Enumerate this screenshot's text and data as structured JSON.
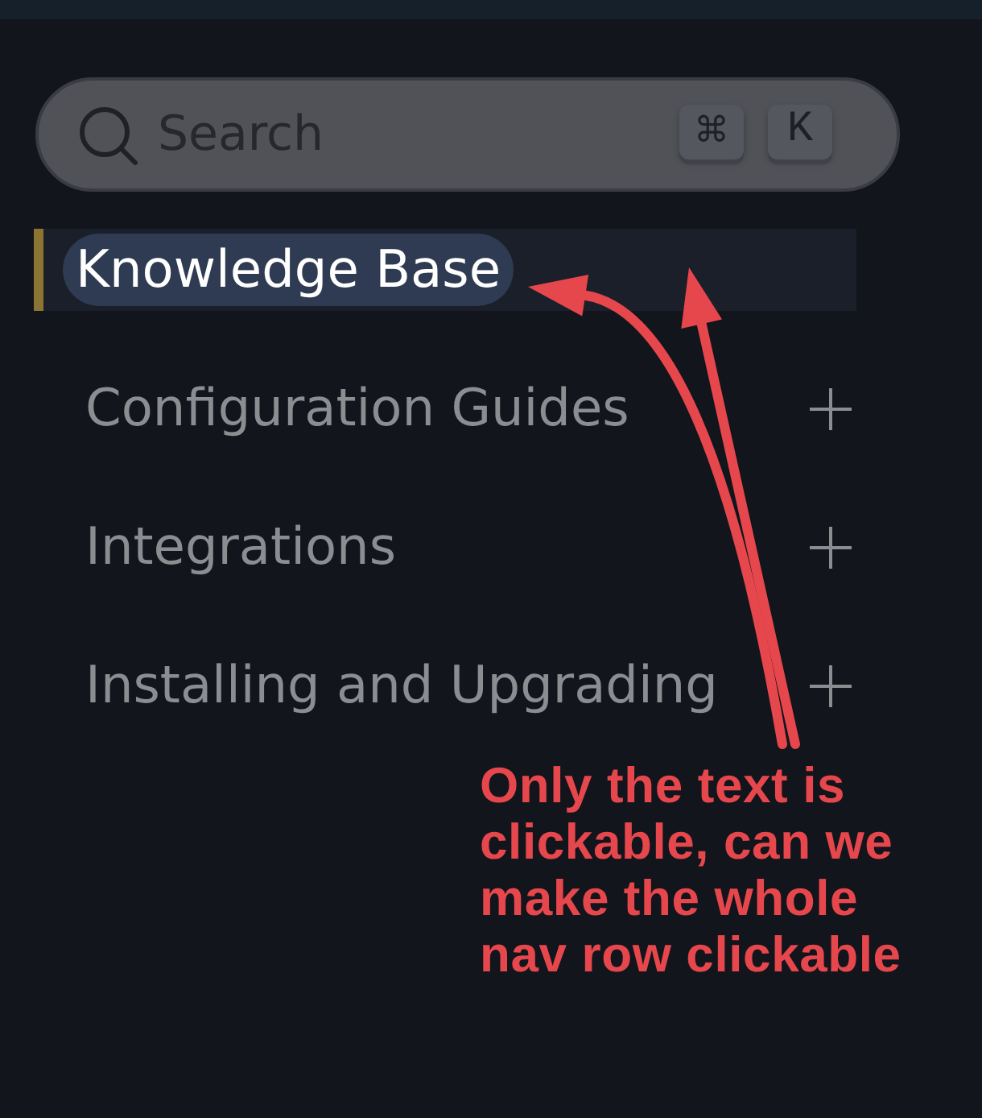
{
  "search": {
    "placeholder": "Search",
    "shortcut_keys": [
      "⌘",
      "K"
    ]
  },
  "nav": {
    "items": [
      {
        "label": "Knowledge Base",
        "selected": true,
        "expandable": false
      },
      {
        "label": "Configuration Guides",
        "selected": false,
        "expandable": true
      },
      {
        "label": "Integrations",
        "selected": false,
        "expandable": true
      },
      {
        "label": "Installing and Upgrading",
        "selected": false,
        "expandable": true
      }
    ]
  },
  "annotation": {
    "text": "Only the text is clickable, can we make the whole nav row clickable"
  }
}
